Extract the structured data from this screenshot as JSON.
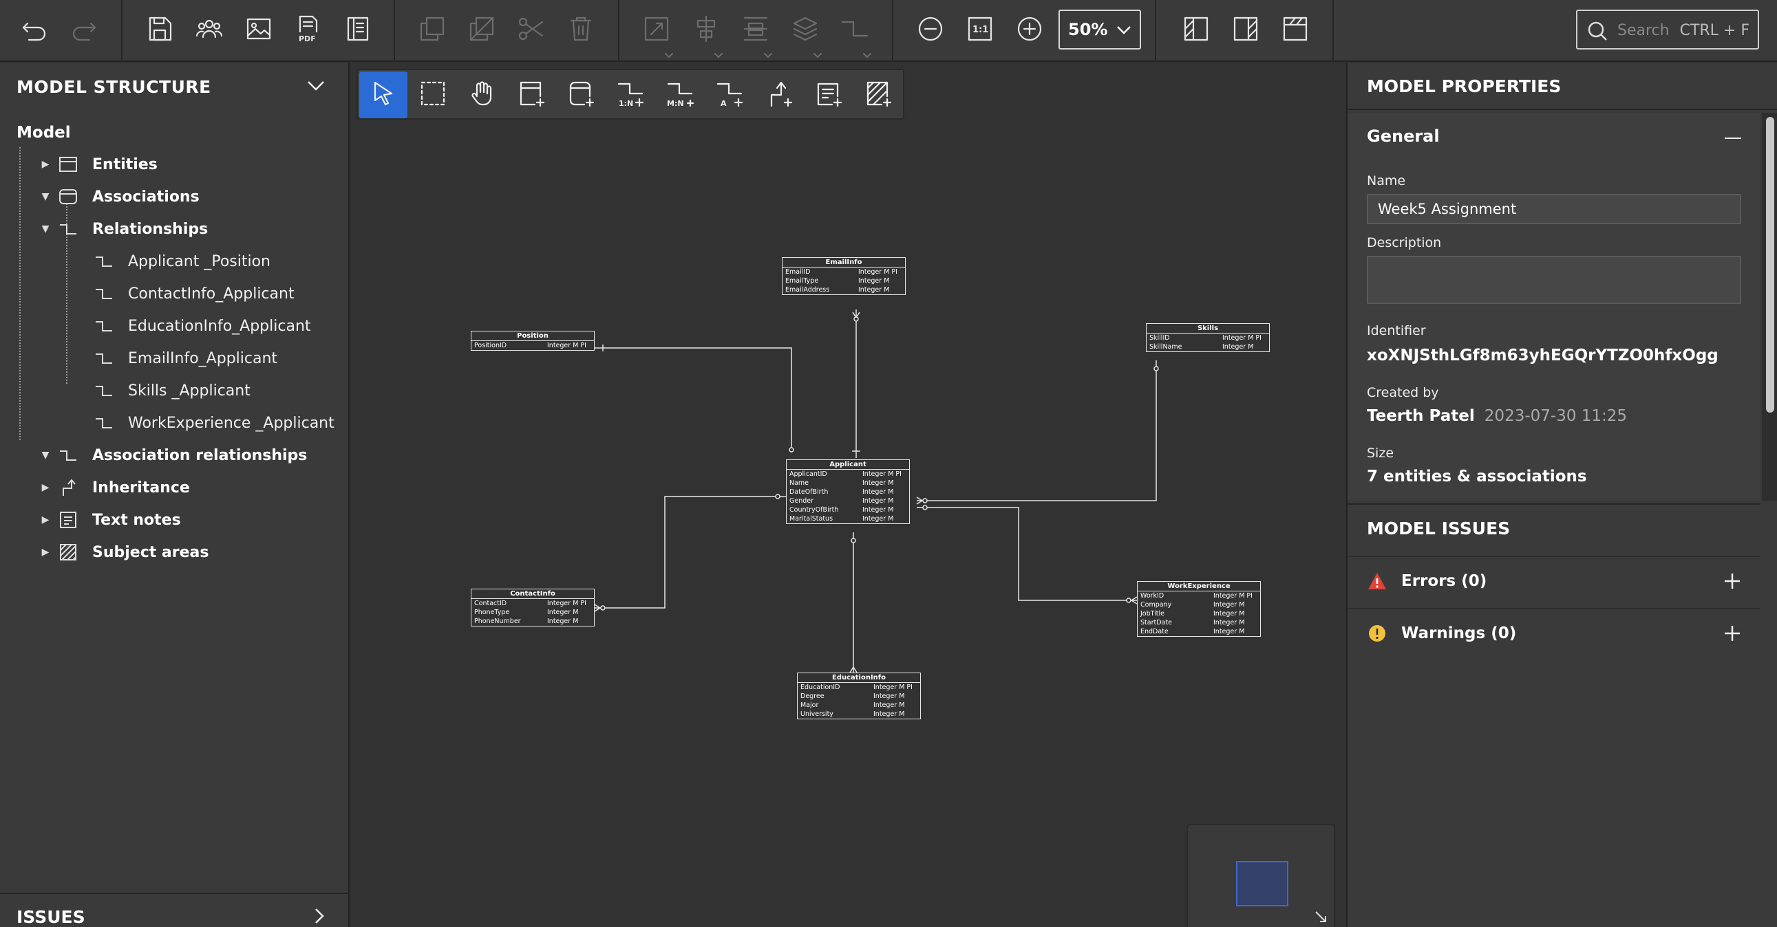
{
  "toolbar": {
    "zoom_value": "50%",
    "search_placeholder": "Search",
    "search_shortcut": "CTRL + F",
    "pdf_label": "PDF",
    "one_to_one_label": "1:1"
  },
  "left_panel": {
    "title": "MODEL STRUCTURE",
    "root": "Model",
    "items": [
      {
        "label": "Entities",
        "expanded": false,
        "icon": "entity-icon"
      },
      {
        "label": "Associations",
        "expanded": true,
        "icon": "association-icon"
      },
      {
        "label": "Relationships",
        "expanded": true,
        "icon": "relationship-icon"
      },
      {
        "label": "Association relationships",
        "expanded": true,
        "icon": "relationship-icon"
      },
      {
        "label": "Inheritance",
        "expanded": false,
        "icon": "inheritance-icon"
      },
      {
        "label": "Text notes",
        "expanded": false,
        "icon": "note-icon"
      },
      {
        "label": "Subject areas",
        "expanded": false,
        "icon": "subject-area-icon"
      }
    ],
    "relationships": [
      "Applicant _Position",
      "ContactInfo_Applicant",
      "EducationInfo_Applicant",
      "EmailInfo_Applicant",
      "Skills _Applicant",
      "WorkExperience _Applicant"
    ],
    "issues_label": "ISSUES"
  },
  "palette": {
    "one_to_many": "1:N",
    "many_to_many": "M:N",
    "association": "A"
  },
  "diagram": {
    "entities": {
      "emailinfo": {
        "name": "EmailInfo",
        "rows": [
          [
            "EmailID",
            "Integer M PI"
          ],
          [
            "EmailType",
            "Integer M"
          ],
          [
            "EmailAddress",
            "Integer M"
          ]
        ]
      },
      "position": {
        "name": "Position",
        "rows": [
          [
            "PositionID",
            "Integer M PI"
          ]
        ]
      },
      "skills": {
        "name": "Skills",
        "rows": [
          [
            "SkillID",
            "Integer M PI"
          ],
          [
            "SkillName",
            "Integer M"
          ]
        ]
      },
      "applicant": {
        "name": "Applicant",
        "rows": [
          [
            "ApplicantID",
            "Integer M PI"
          ],
          [
            "Name",
            "Integer M"
          ],
          [
            "DateOfBirth",
            "Integer M"
          ],
          [
            "Gender",
            "Integer M"
          ],
          [
            "CountryOfBirth",
            "Integer M"
          ],
          [
            "MaritalStatus",
            "Integer M"
          ]
        ]
      },
      "contactinfo": {
        "name": "ContactInfo",
        "rows": [
          [
            "ContactID",
            "Integer M PI"
          ],
          [
            "PhoneType",
            "Integer M"
          ],
          [
            "PhoneNumber",
            "Integer M"
          ]
        ]
      },
      "workexperience": {
        "name": "WorkExperience",
        "rows": [
          [
            "WorkID",
            "Integer M PI"
          ],
          [
            "Company",
            "Integer M"
          ],
          [
            "JobTitle",
            "Integer M"
          ],
          [
            "StartDate",
            "Integer M"
          ],
          [
            "EndDate",
            "Integer M"
          ]
        ]
      },
      "educationinfo": {
        "name": "EducationInfo",
        "rows": [
          [
            "EducationID",
            "Integer M PI"
          ],
          [
            "Degree",
            "Integer M"
          ],
          [
            "Major",
            "Integer M"
          ],
          [
            "University",
            "Integer M"
          ]
        ]
      }
    }
  },
  "right_panel": {
    "title": "MODEL PROPERTIES",
    "general": {
      "title": "General",
      "name_label": "Name",
      "name_value": "Week5 Assignment",
      "description_label": "Description",
      "description_value": "",
      "identifier_label": "Identifier",
      "identifier_value": "xoXNJSthLGf8m63yhEGQrYTZO0hfxOgg",
      "created_label": "Created by",
      "created_by": "Teerth Patel",
      "created_at": "2023-07-30 11:25",
      "size_label": "Size",
      "size_value": "7 entities & associations"
    },
    "issues": {
      "title": "MODEL ISSUES",
      "errors": "Errors (0)",
      "warnings": "Warnings (0)"
    }
  },
  "colors": {
    "accent": "#2b6bd6",
    "error": "#e0443a",
    "warning": "#f0c23c"
  }
}
